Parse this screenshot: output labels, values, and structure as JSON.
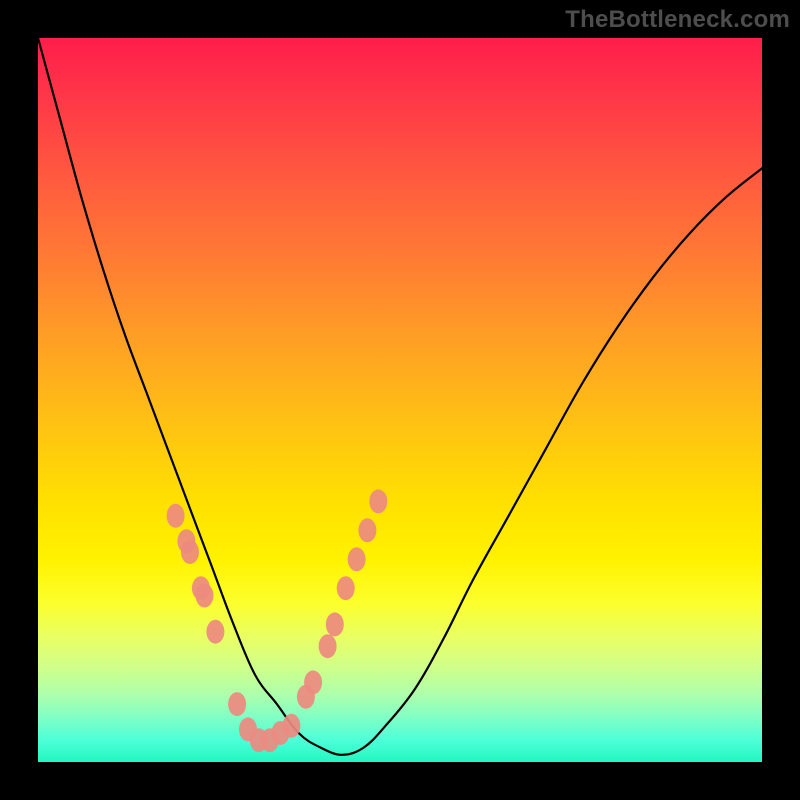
{
  "watermark": "TheBottleneck.com",
  "colors": {
    "frame": "#000000",
    "gradient_top": "#ff1e4a",
    "gradient_bottom": "#22f7c0",
    "curve": "#000000",
    "marker": "#ed8a80"
  },
  "chart_data": {
    "type": "line",
    "title": "",
    "xlabel": "",
    "ylabel": "",
    "xlim": [
      0,
      100
    ],
    "ylim": [
      0,
      100
    ],
    "x_min_point": 30,
    "series": [
      {
        "name": "curve",
        "x": [
          0,
          3,
          6,
          9,
          12,
          15,
          18,
          21,
          24,
          27,
          30,
          33,
          36,
          39,
          42,
          45,
          48,
          52,
          56,
          60,
          65,
          70,
          75,
          80,
          85,
          90,
          95,
          100
        ],
        "values": [
          100,
          89,
          78,
          68,
          59,
          51,
          43,
          35,
          27,
          19,
          12,
          8,
          4,
          2,
          1,
          2,
          5,
          10,
          17,
          25,
          34,
          43,
          52,
          60,
          67,
          73,
          78,
          82
        ]
      },
      {
        "name": "markers_left",
        "x": [
          19.0,
          20.5,
          21.0,
          22.5,
          23.0,
          24.5,
          27.5,
          29.0,
          30.5
        ],
        "values": [
          34.0,
          30.5,
          29.0,
          24.0,
          23.0,
          18.0,
          8.0,
          4.5,
          3.0
        ]
      },
      {
        "name": "markers_right",
        "x": [
          32.0,
          33.5,
          35.0,
          37.0,
          38.0,
          40.0,
          41.0,
          42.5,
          44.0,
          45.5,
          47.0
        ],
        "values": [
          3.0,
          4.0,
          5.0,
          9.0,
          11.0,
          16.0,
          19.0,
          24.0,
          28.0,
          32.0,
          36.0
        ]
      }
    ]
  }
}
